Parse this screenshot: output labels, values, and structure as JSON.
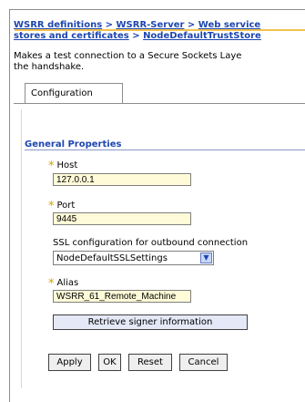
{
  "breadcrumb": {
    "line1": [
      "WSRR definitions",
      "WSRR-Server",
      "Web service"
    ],
    "line2": [
      "stores and certificates",
      "NodeDefaultTrustStore"
    ],
    "separator": " > "
  },
  "description": {
    "line1": "Makes a test connection to a Secure Sockets Laye",
    "line2": "the handshake."
  },
  "tabs": [
    {
      "label": "Configuration"
    }
  ],
  "section": {
    "title": "General Properties"
  },
  "required_mark": "*",
  "fields": {
    "host": {
      "label": "Host",
      "value": "127.0.0.1"
    },
    "port": {
      "label": "Port",
      "value": "9445"
    },
    "ssl_config": {
      "label": "SSL configuration for outbound connection",
      "value": "NodeDefaultSSLSettings"
    },
    "alias": {
      "label": "Alias",
      "value": "WSRR_61_Remote_Machine"
    }
  },
  "buttons": {
    "retrieve": "Retrieve signer information",
    "apply": "Apply",
    "ok": "OK",
    "reset": "Reset",
    "cancel": "Cancel"
  },
  "icons": {
    "select_arrow": "chevron-down-icon"
  },
  "colors": {
    "link": "#1d46b0",
    "accent_rule": "#f2c44a",
    "field_bg": "#fffbd8",
    "required": "#d2a300"
  }
}
